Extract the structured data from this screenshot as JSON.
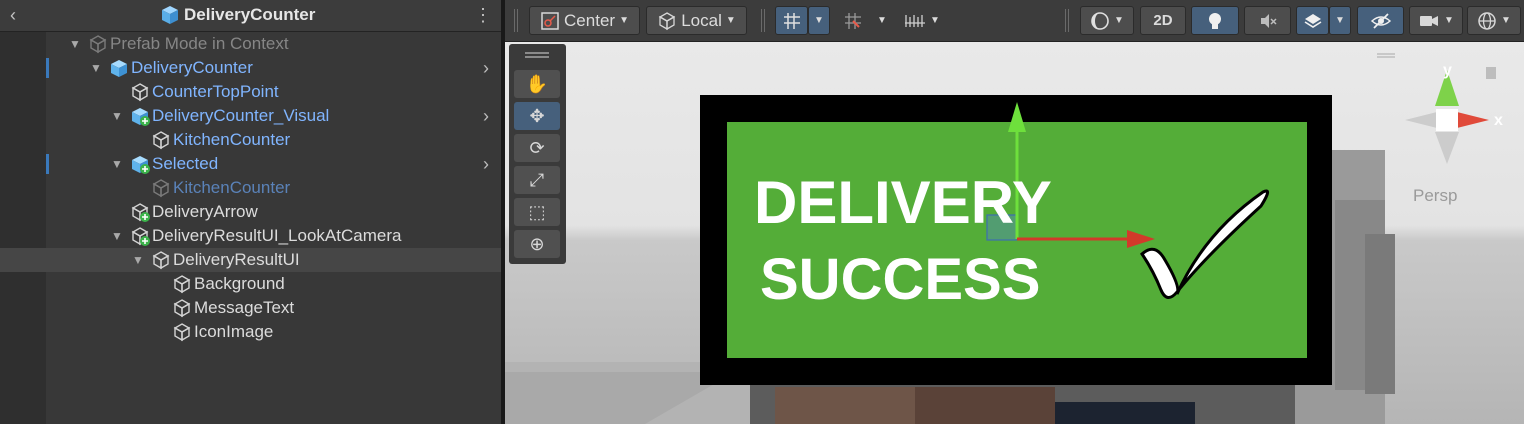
{
  "hierarchy": {
    "title": "DeliveryCounter",
    "rows": [
      {
        "label": "Prefab Mode in Context",
        "style": "gray",
        "depth": 0,
        "fold": "down",
        "icon": "cube-gray"
      },
      {
        "label": "DeliveryCounter",
        "style": "blue",
        "depth": 1,
        "fold": "down",
        "icon": "cube-blue",
        "chevron": true,
        "marker": true
      },
      {
        "label": "CounterTopPoint",
        "style": "blue",
        "depth": 2,
        "fold": "",
        "icon": "cube-outline"
      },
      {
        "label": "DeliveryCounter_Visual",
        "style": "blue",
        "depth": 2,
        "fold": "down",
        "icon": "cube-added",
        "chevron": true
      },
      {
        "label": "KitchenCounter",
        "style": "blue",
        "depth": 3,
        "fold": "",
        "icon": "cube-outline"
      },
      {
        "label": "Selected",
        "style": "blue",
        "depth": 2,
        "fold": "down",
        "icon": "cube-added",
        "chevron": true,
        "marker": true
      },
      {
        "label": "KitchenCounter",
        "style": "dimblue",
        "depth": 3,
        "fold": "",
        "icon": "cube-gray"
      },
      {
        "label": "DeliveryArrow",
        "style": "white",
        "depth": 2,
        "fold": "",
        "icon": "cube-outline-added"
      },
      {
        "label": "DeliveryResultUI_LookAtCamera",
        "style": "white",
        "depth": 2,
        "fold": "down",
        "icon": "cube-outline-added"
      },
      {
        "label": "DeliveryResultUI",
        "style": "white",
        "depth": 3,
        "fold": "down",
        "icon": "cube-outline",
        "selected": true
      },
      {
        "label": "Background",
        "style": "white",
        "depth": 4,
        "fold": "",
        "icon": "cube-outline"
      },
      {
        "label": "MessageText",
        "style": "white",
        "depth": 4,
        "fold": "",
        "icon": "cube-outline"
      },
      {
        "label": "IconImage",
        "style": "white",
        "depth": 4,
        "fold": "",
        "icon": "cube-outline"
      }
    ]
  },
  "toolbar": {
    "pivot": "Center",
    "space": "Local",
    "mode_2d": "2D"
  },
  "scene": {
    "sign_line1": "DELIVERY",
    "sign_line2": "SUCCESS",
    "gizmo_x": "x",
    "gizmo_y": "y",
    "persp": "Persp"
  },
  "colors": {
    "sign_green": "#54ad38",
    "hierarchy_blue": "#80b5ff",
    "selection_blue": "#46607c"
  }
}
